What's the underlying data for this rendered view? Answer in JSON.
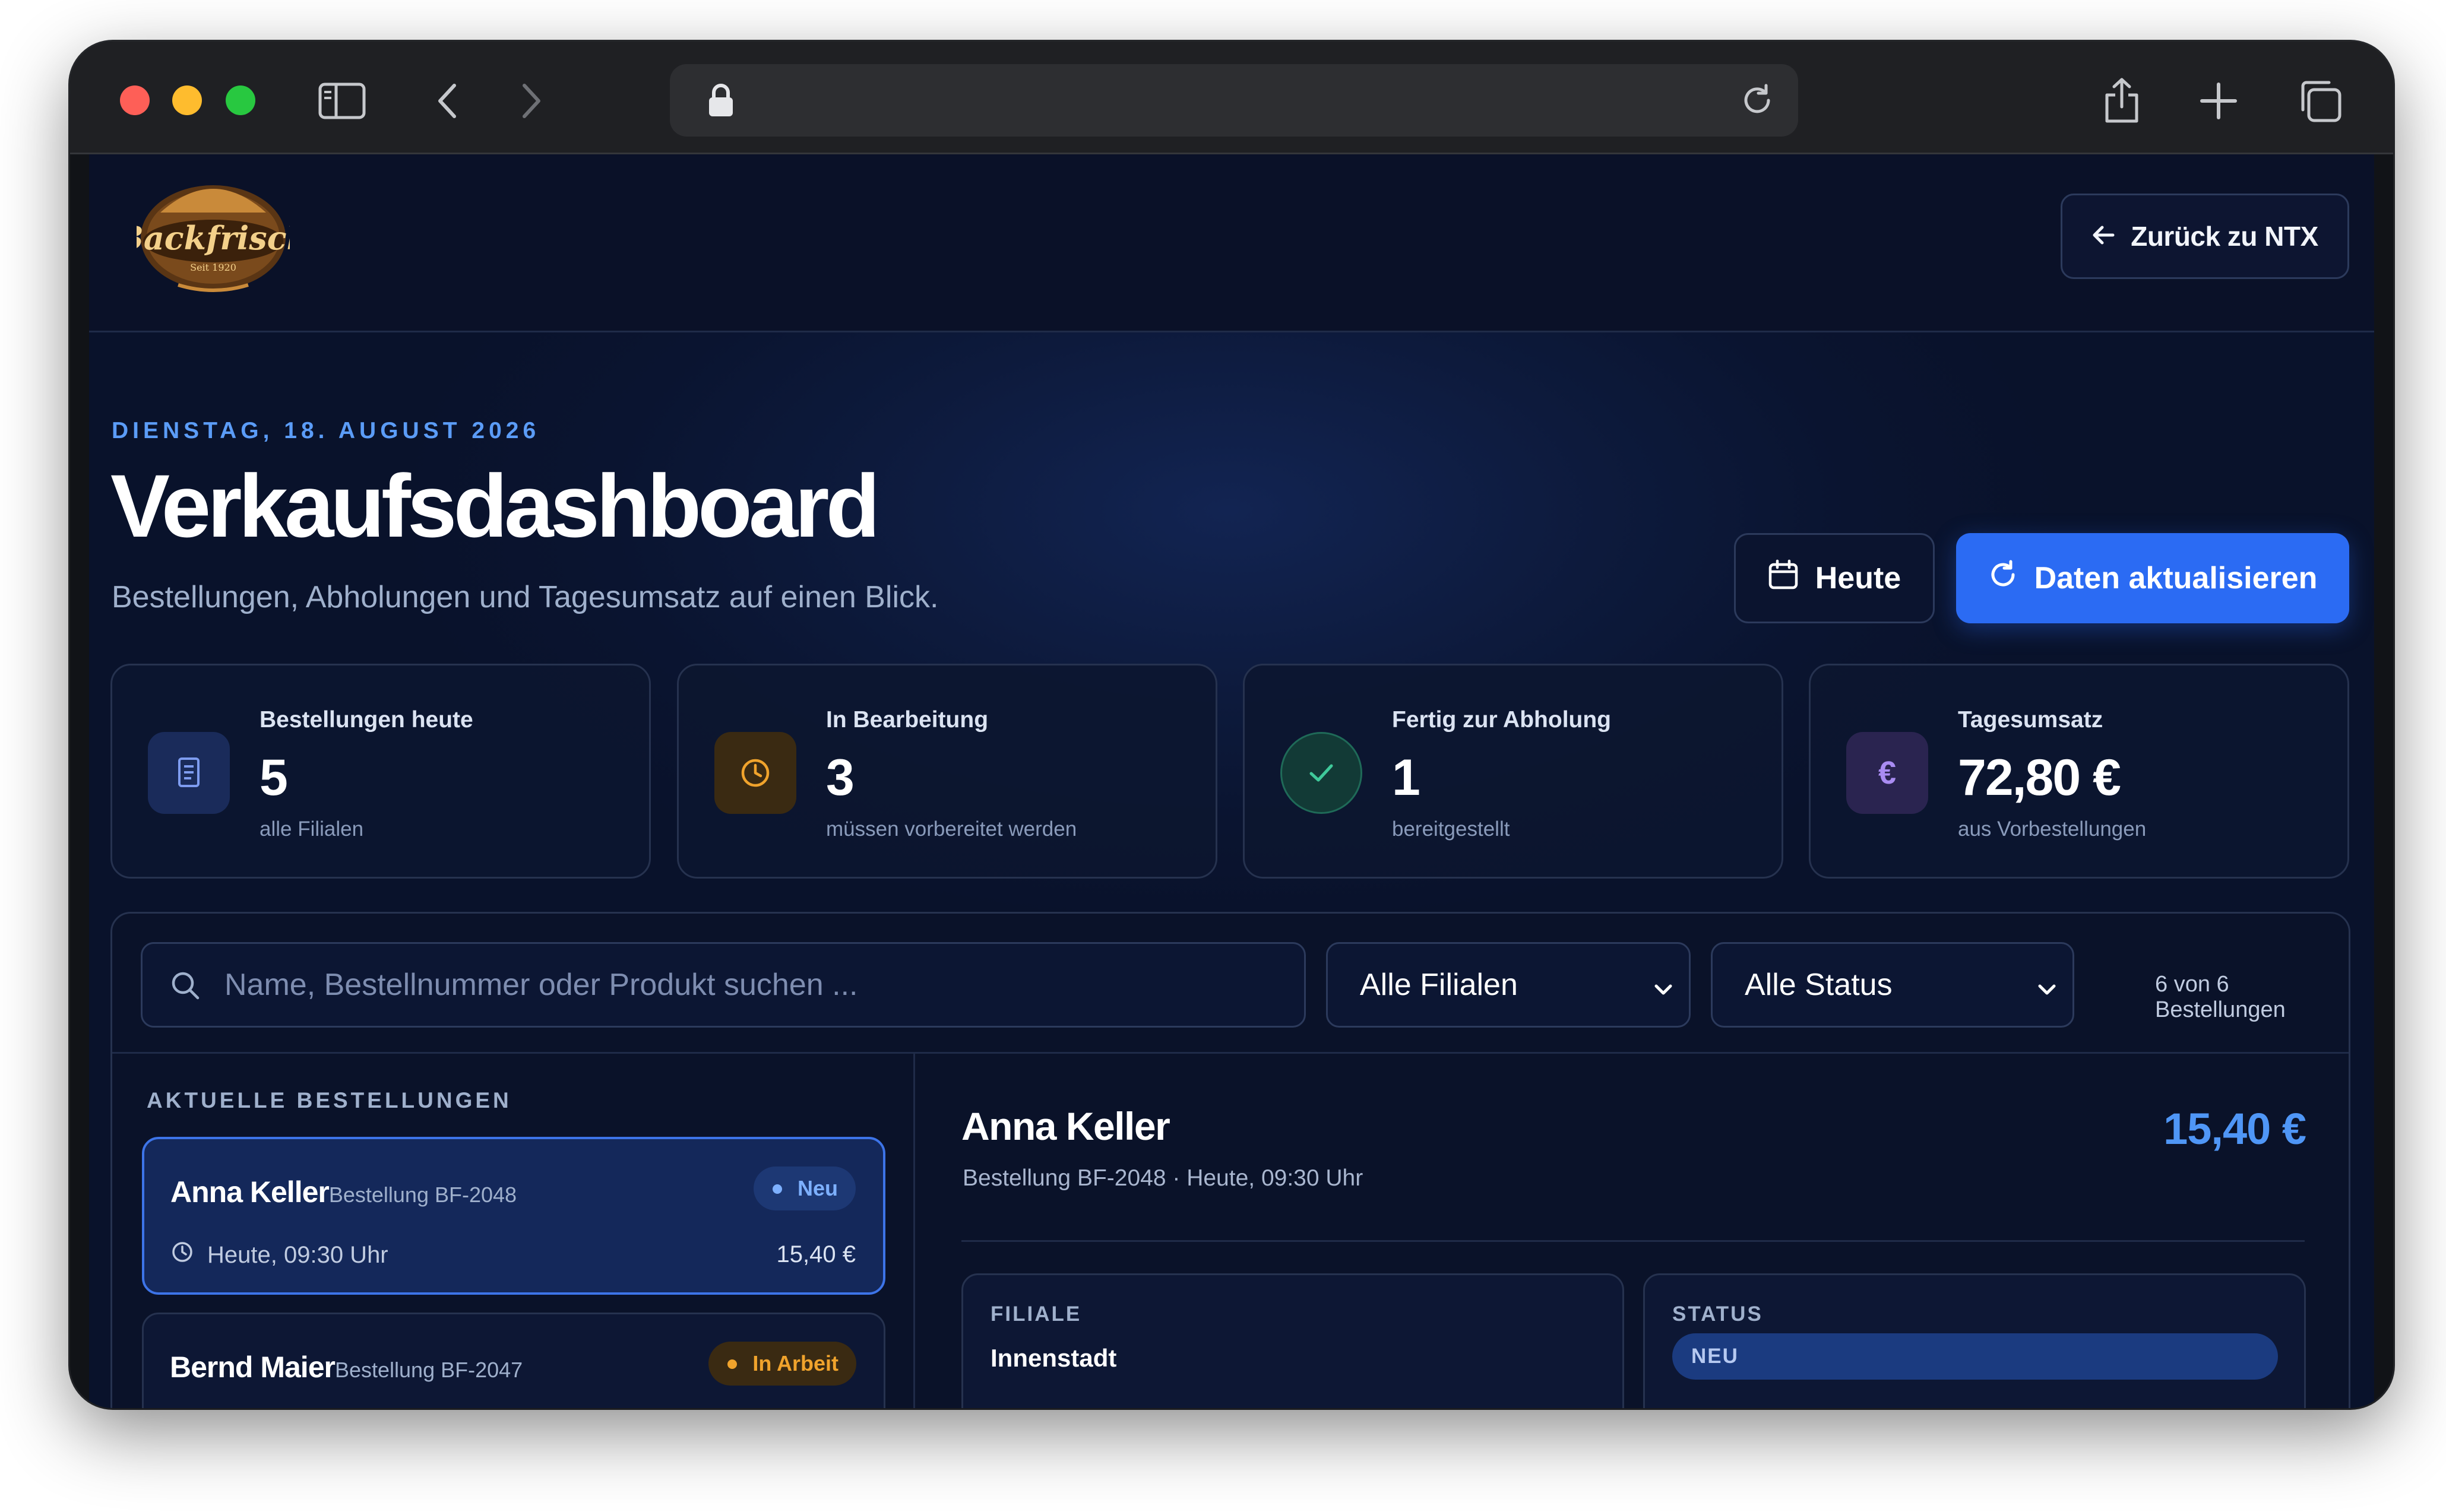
{
  "browser": {
    "url": ""
  },
  "header": {
    "logo_text": "Backfrisch",
    "logo_tagline": "Seit 1920",
    "back_label": "Zurück zu NTX"
  },
  "hero": {
    "date": "DIENSTAG, 18. AUGUST 2026",
    "title": "Verkaufsdashboard",
    "subtitle": "Bestellungen, Abholungen und Tagesumsatz auf einen Blick.",
    "today_label": "Heute",
    "refresh_label": "Daten aktualisieren"
  },
  "stats": [
    {
      "label": "Bestellungen heute",
      "value": "5",
      "note": "alle Filialen",
      "icon": "document-icon",
      "color": "#7e9cf0"
    },
    {
      "label": "In Bearbeitung",
      "value": "3",
      "note": "müssen vorbereitet werden",
      "icon": "clock-icon",
      "color": "#f0a32c"
    },
    {
      "label": "Fertig zur Abholung",
      "value": "1",
      "note": "bereitgestellt",
      "icon": "check-icon",
      "color": "#3fc99a"
    },
    {
      "label": "Tagesumsatz",
      "value": "72,80 €",
      "note": "aus Vorbestellungen",
      "icon": "euro-icon",
      "color": "#a98cf2"
    }
  ],
  "filters": {
    "search_placeholder": "Name, Bestellnummer oder Produkt suchen ...",
    "branch": "Alle Filialen",
    "status": "Alle Status",
    "count_text": "6 von 6 Bestellungen"
  },
  "orders": {
    "heading": "AKTUELLE BESTELLUNGEN",
    "items": [
      {
        "name": "Anna Keller",
        "order": "Bestellung BF-2048",
        "badge": "Neu",
        "time": "Heute, 09:30 Uhr",
        "amount": "15,40 €",
        "badge_color": "#5b9cf7"
      },
      {
        "name": "Bernd Maier",
        "order": "Bestellung BF-2047",
        "badge": "In Arbeit",
        "time": "",
        "amount": "",
        "badge_color": "#f0a32c"
      }
    ]
  },
  "detail": {
    "name": "Anna Keller",
    "meta": "Bestellung BF-2048 · Heute, 09:30 Uhr",
    "total": "15,40 €",
    "branch_label": "FILIALE",
    "branch_value": "Innenstadt",
    "status_label": "STATUS",
    "status_value": "NEU"
  },
  "colors": {
    "accent": "#2b6bf3",
    "page_bg": "#0a1430",
    "kicker": "#5b9cf7"
  }
}
